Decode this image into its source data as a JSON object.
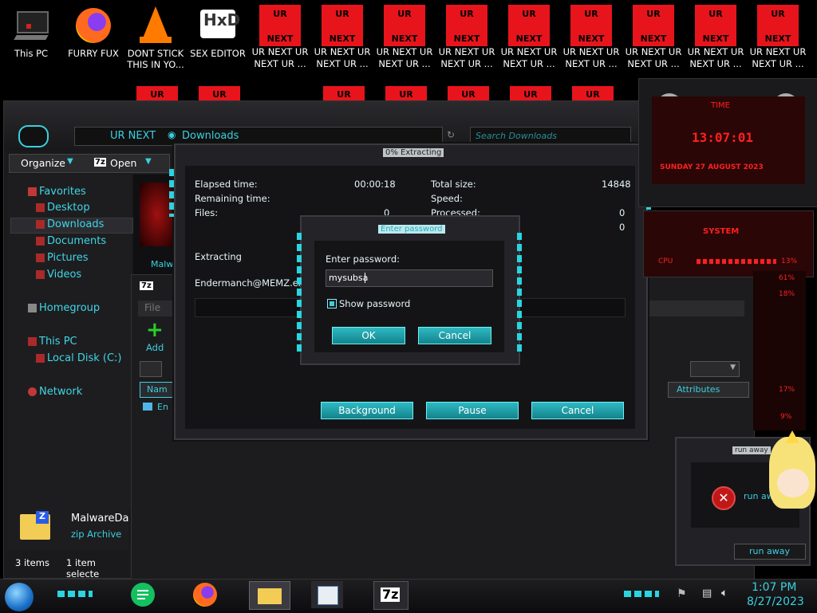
{
  "desktop": {
    "icons": [
      {
        "label": "This PC",
        "icon": "computer-icon"
      },
      {
        "label": "FURRY FUX",
        "icon": "firefox-icon"
      },
      {
        "label": "DONT STICK THIS IN YO...",
        "icon": "vlc-cone-icon"
      },
      {
        "label": "SEX EDITOR",
        "icon": "hxd-icon"
      }
    ],
    "red_top": "UR",
    "red_bottom": "NEXT",
    "red_label_line1": "UR NEXT UR",
    "red_label_line2": "NEXT UR ...",
    "red_count": 9,
    "red_second_row_count": 7
  },
  "explorer": {
    "breadcrumb": [
      "UR NEXT",
      "Downloads"
    ],
    "search_placeholder": "Search Downloads",
    "toolbar": {
      "organize": "Organize",
      "open": "Open",
      "open_badge": "7z"
    },
    "nav": {
      "favorites": "Favorites",
      "desktop": "Desktop",
      "downloads": "Downloads",
      "documents": "Documents",
      "pictures": "Pictures",
      "videos": "Videos",
      "homegroup": "Homegroup",
      "this_pc": "This PC",
      "local_disk": "Local Disk (C:)",
      "network": "Network"
    },
    "partial_file": "Malw",
    "details": {
      "name": "MalwareDa",
      "type": "zip Archive"
    },
    "status": {
      "items": "3 items",
      "selected": "1 item selecte"
    }
  },
  "sevenzip": {
    "title_badge": "7z",
    "menu_file": "File",
    "add_label": "Add",
    "col_name": "Nam",
    "col_attributes": "Attributes",
    "file_prefix": "En"
  },
  "extract": {
    "title": "0% Extracting",
    "elapsed_label": "Elapsed time:",
    "elapsed_value": "00:00:18",
    "remaining_label": "Remaining time:",
    "files_label": "Files:",
    "files_value": "0",
    "total_label": "Total size:",
    "total_value": "14848",
    "speed_label": "Speed:",
    "processed_label": "Processed:",
    "processed_value": "0",
    "extra_value": "0",
    "extracting_label": "Extracting",
    "current_file": "Endermanch@MEMZ.exe",
    "background_btn": "Background",
    "pause_btn": "Pause",
    "cancel_btn": "Cancel"
  },
  "password": {
    "title": "Enter password",
    "prompt": "Enter password:",
    "value": "mysubsa",
    "show_label": "Show password",
    "show_checked": true,
    "ok": "OK",
    "cancel": "Cancel"
  },
  "widget": {
    "time_title": "TIME",
    "time": "13:07:01",
    "date": "SUNDAY 27 AUGUST 2023",
    "system_title": "SYSTEM",
    "cpu_label": "CPU",
    "pct1": "13%",
    "pct2": "61%",
    "pct3": "18%",
    "pct4": "17%",
    "pct5": "9%"
  },
  "runaway": {
    "title": "run away",
    "message": "run aw",
    "button": "run away"
  },
  "taskbar": {
    "time": "1:07 PM",
    "date": "8/27/2023",
    "sevenzip_badge": "7z"
  },
  "colors": {
    "accent": "#3ad0e0",
    "red": "#e8141c",
    "panel": "#1c1c1e"
  }
}
